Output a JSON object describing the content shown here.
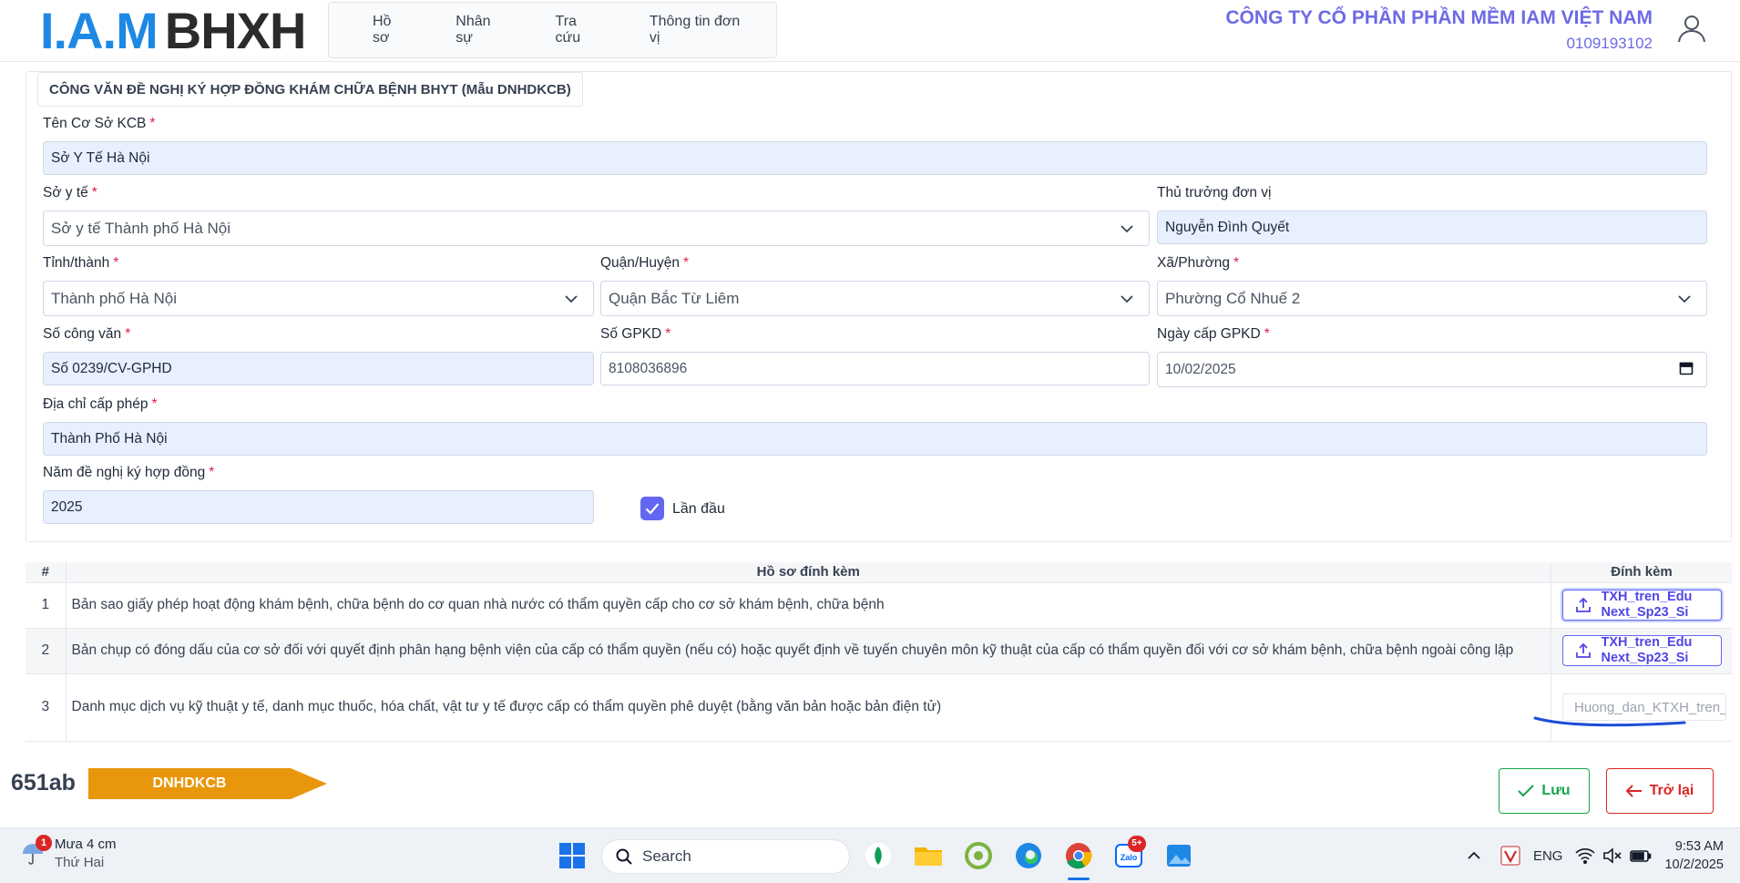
{
  "header": {
    "logo": {
      "iam": "I.A.M",
      "bhxh": "BHXH"
    },
    "nav": [
      "Hồ sơ",
      "Nhân sự",
      "Tra cứu",
      "Thông tin đơn vị"
    ],
    "company_name": "CÔNG TY CỔ PHẦN PHẦN MỀM IAM VIỆT NAM",
    "company_code": "0109193102",
    "user_icon": "user-icon"
  },
  "form": {
    "title": "CÔNG VĂN ĐỀ NGHỊ KÝ HỢP ĐỒNG KHÁM CHỮA BỆNH BHYT (Mẫu DNHDKCB)",
    "required_mark": "*",
    "facility_name": {
      "label": "Tên Cơ Sở KCB",
      "value": "Sở Y Tế Hà Nội"
    },
    "health_dept": {
      "label": "Sở y tế",
      "value": "Sở y tế Thành phố Hà Nội"
    },
    "head_of_unit": {
      "label": "Thủ trưởng đơn vị",
      "value": "Nguyễn Đình Quyết"
    },
    "province": {
      "label": "Tỉnh/thành",
      "value": "Thành phố Hà Nội"
    },
    "district": {
      "label": "Quận/Huyện",
      "value": "Quận Bắc Từ Liêm"
    },
    "ward": {
      "label": "Xã/Phường",
      "value": "Phường Cổ Nhuế 2"
    },
    "dispatch_no": {
      "label": "Số công văn",
      "value": "Số 0239/CV-GPHD"
    },
    "license_no": {
      "label": "Số GPKD",
      "value": "8108036896"
    },
    "license_date": {
      "label": "Ngày cấp GPKD",
      "value": "10/02/2025"
    },
    "license_address": {
      "label": "Địa chỉ cấp phép",
      "value": "Thành Phố Hà Nội"
    },
    "contract_year": {
      "label": "Năm đề nghị ký hợp đồng",
      "value": "2025"
    },
    "first_time": {
      "label": "Lần đầu",
      "checked": true
    }
  },
  "attachments": {
    "headers": {
      "num": "#",
      "doc": "Hồ sơ đính kèm",
      "att": "Đính kèm"
    },
    "rows": [
      {
        "num": "1",
        "doc": "Bản sao giấy phép hoạt động khám bệnh, chữa bệnh do cơ quan nhà nước có thẩm quyền cấp cho cơ sở khám bệnh, chữa bệnh",
        "file_line1": "TXH_tren_Edu",
        "file_line2": "Next_Sp23_Si"
      },
      {
        "num": "2",
        "doc": "Bản chụp có đóng dấu của cơ sở đối với quyết định phân hạng bệnh viện của cấp có thẩm quyền (nếu có) hoặc quyết định về tuyến chuyên môn kỹ thuật của cấp có thẩm quyền đối với cơ sở khám bệnh, chữa bệnh ngoài công lập",
        "file_line1": "TXH_tren_Edu",
        "file_line2": "Next_Sp23_Si"
      },
      {
        "num": "3",
        "doc": "Danh mục dịch vụ kỹ thuật y tế, danh mục thuốc, hóa chất, vật tư y tế được cấp có thẩm quyền phê duyệt (bằng văn bản hoặc bản điện tử)",
        "file_name": "Huong_dan_KTXH_tren_"
      }
    ]
  },
  "footer": {
    "code": "651ab",
    "tag": "DNHDKCB",
    "tag_color": "#e8970c",
    "save_label": "Lưu",
    "back_label": "Trở lại"
  },
  "taskbar": {
    "weather_badge": "1",
    "weather_line1": "Mưa 4 cm",
    "weather_line2": "Thứ Hai",
    "search_label": "Search",
    "zalo_badge": "5+",
    "lang": "ENG",
    "time": "9:53 AM",
    "date": "10/2/2025"
  },
  "colors": {
    "accent": "#6366f1",
    "brand_blue": "#1e88e5",
    "company": "#6d6ae6",
    "save": "#16a34a",
    "back": "#dc2626"
  }
}
